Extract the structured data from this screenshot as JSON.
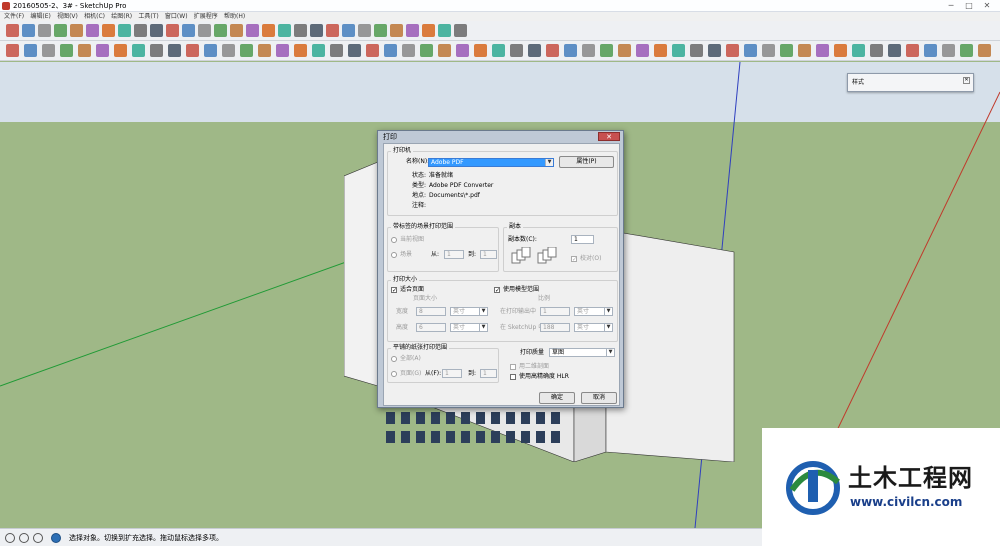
{
  "window": {
    "title": "20160505-2、3# - SketchUp Pro"
  },
  "menu": [
    "文件(F)",
    "编辑(E)",
    "视图(V)",
    "相机(C)",
    "绘图(R)",
    "工具(T)",
    "窗口(W)",
    "扩展程序",
    "帮助(H)"
  ],
  "styles_panel": {
    "title": "样式"
  },
  "print_dialog": {
    "title": "打印",
    "close": "✕",
    "printer": {
      "group": "打印机",
      "name_label": "名称(N):",
      "name_value": "Adobe PDF",
      "properties_button": "属性(P)",
      "status_label": "状态:",
      "status_value": "准备就绪",
      "type_label": "类型:",
      "type_value": "Adobe PDF Converter",
      "where_label": "地点:",
      "where_value": "Documents\\*.pdf",
      "comment_label": "注释:",
      "comment_value": ""
    },
    "scene_range": {
      "group": "带标签的场景打印范围",
      "current_view": "当前视图",
      "scenes": "场景",
      "from_label": "从:",
      "from_value": "1",
      "to_label": "到:",
      "to_value": "1"
    },
    "copies": {
      "group": "副本",
      "count_label": "副本数(C):",
      "count_value": "1",
      "collate_label": "校对(O)"
    },
    "print_size": {
      "group": "打印大小",
      "fit_page_label": "适合页面",
      "use_extents_label": "使用模型范围",
      "page_size_label": "页面大小",
      "scale_label": "比例",
      "width_label": "宽度",
      "width_value": "8",
      "height_label": "高度",
      "height_value": "6",
      "unit": "英寸",
      "printout_label": "在打印输出中",
      "printout_value": "1",
      "sketchup_label": "在 SketchUp 中",
      "sketchup_value": "188"
    },
    "tiled_range": {
      "group": "平铺的纸张打印范围",
      "all_label": "全部(A)",
      "pages_label": "页面(G)",
      "from_label": "从(F):",
      "from_value": "1",
      "to_label": "到:",
      "to_value": "1"
    },
    "quality": {
      "label": "打印质量",
      "value": "草图",
      "two_d_label": "用二维剖面",
      "hlr_label": "使用高精确度 HLR"
    },
    "ok": "确定",
    "cancel": "取消"
  },
  "status": {
    "text": "选择对象。切换到扩充选择。拖动鼠标选择多项。"
  },
  "watermark": {
    "title": "土木工程网",
    "url": "www.civilcn.com"
  }
}
